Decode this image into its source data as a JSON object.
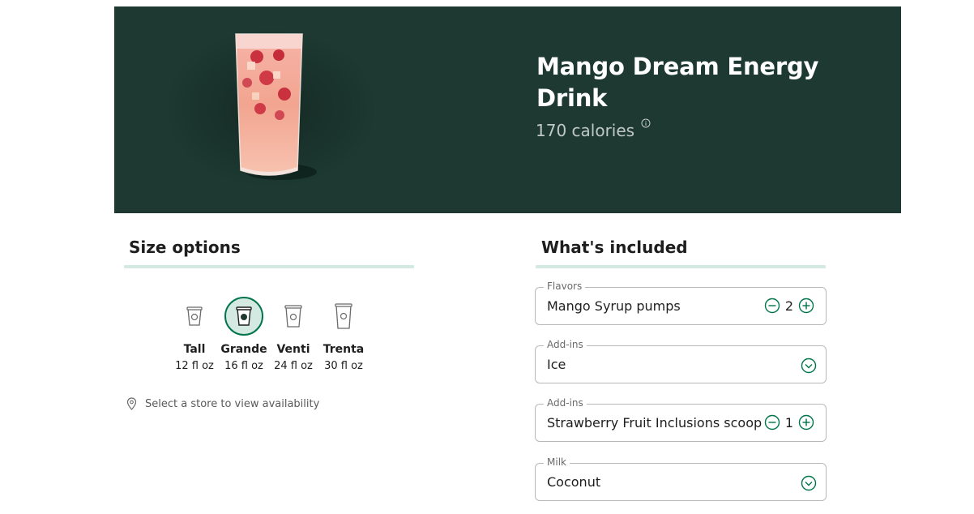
{
  "product": {
    "title": "Mango Dream Energy Drink",
    "calories": "170 calories"
  },
  "size_section": {
    "title": "Size options",
    "sizes": [
      {
        "name": "Tall",
        "volume": "12 fl oz",
        "selected": false
      },
      {
        "name": "Grande",
        "volume": "16 fl oz",
        "selected": true
      },
      {
        "name": "Venti",
        "volume": "24 fl oz",
        "selected": false
      },
      {
        "name": "Trenta",
        "volume": "30 fl oz",
        "selected": false
      }
    ],
    "store_prompt": "Select a store to view availability"
  },
  "included_section": {
    "title": "What's included",
    "fields": [
      {
        "label": "Flavors",
        "value": "Mango Syrup pumps",
        "control": "stepper",
        "count": "2"
      },
      {
        "label": "Add-ins",
        "value": "Ice",
        "control": "dropdown"
      },
      {
        "label": "Add-ins",
        "value": "Strawberry Fruit Inclusions scoop",
        "control": "stepper",
        "count": "1"
      },
      {
        "label": "Milk",
        "value": "Coconut",
        "control": "dropdown"
      }
    ]
  },
  "colors": {
    "hero_bg": "#1e3932",
    "accent_green": "#00754a",
    "light_green": "#d4e9e2"
  },
  "icons": [
    "info-icon",
    "cup-icon",
    "location-pin-icon",
    "minus-circle-icon",
    "plus-circle-icon",
    "chevron-down-icon"
  ]
}
